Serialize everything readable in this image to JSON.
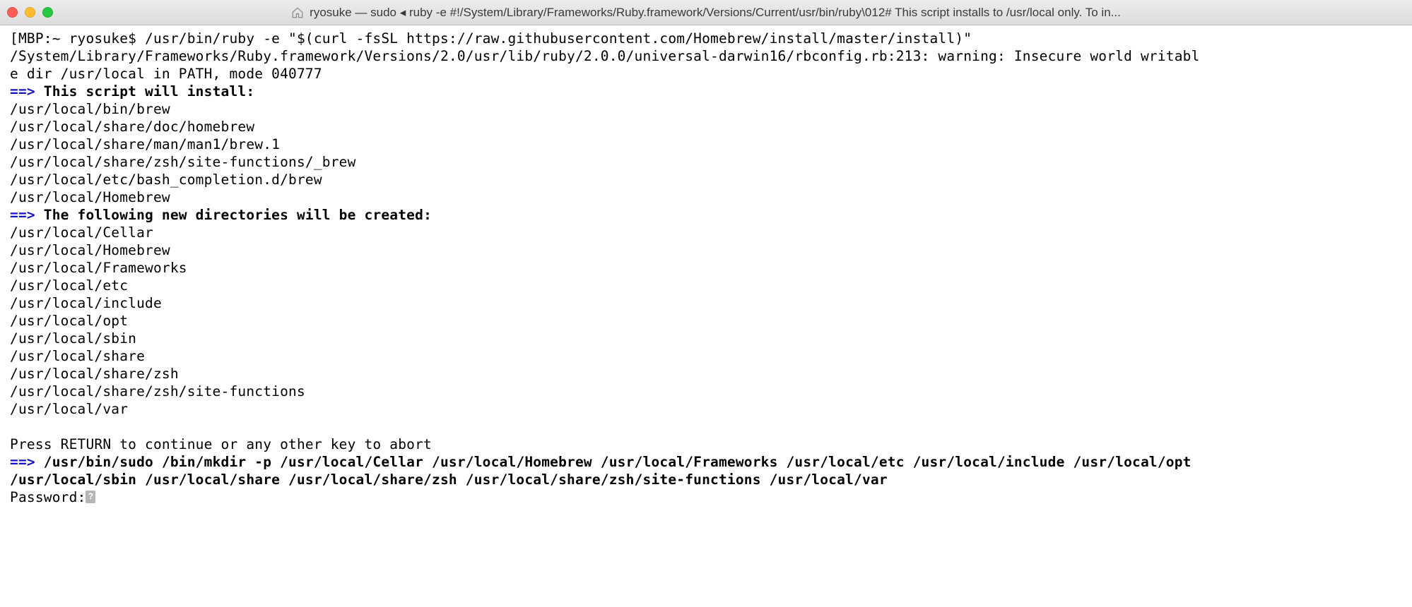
{
  "window": {
    "title": "ryosuke — sudo ◂ ruby -e #!/System/Library/Frameworks/Ruby.framework/Versions/Current/usr/bin/ruby\\012# This script installs to /usr/local only. To in..."
  },
  "term": {
    "prompt": "[MBP:~ ryosuke$ ",
    "command": "/usr/bin/ruby -e \"$(curl -fsSL https://raw.githubusercontent.com/Homebrew/install/master/install)\"",
    "warning": "/System/Library/Frameworks/Ruby.framework/Versions/2.0/usr/lib/ruby/2.0.0/universal-darwin16/rbconfig.rb:213: warning: Insecure world writabl\ne dir /usr/local in PATH, mode 040777",
    "arrow": "==> ",
    "install_header": "This script will install:",
    "install_paths": "/usr/local/bin/brew\n/usr/local/share/doc/homebrew\n/usr/local/share/man/man1/brew.1\n/usr/local/share/zsh/site-functions/_brew\n/usr/local/etc/bash_completion.d/brew\n/usr/local/Homebrew",
    "dirs_header": "The following new directories will be created:",
    "dirs_paths": "/usr/local/Cellar\n/usr/local/Homebrew\n/usr/local/Frameworks\n/usr/local/etc\n/usr/local/include\n/usr/local/opt\n/usr/local/sbin\n/usr/local/share\n/usr/local/share/zsh\n/usr/local/share/zsh/site-functions\n/usr/local/var",
    "continue_prompt": "Press RETURN to continue or any other key to abort",
    "sudo_cmd": "/usr/bin/sudo /bin/mkdir -p /usr/local/Cellar /usr/local/Homebrew /usr/local/Frameworks /usr/local/etc /usr/local/include /usr/local/opt \n/usr/local/sbin /usr/local/share /usr/local/share/zsh /usr/local/share/zsh/site-functions /usr/local/var",
    "password_label": "Password:"
  }
}
